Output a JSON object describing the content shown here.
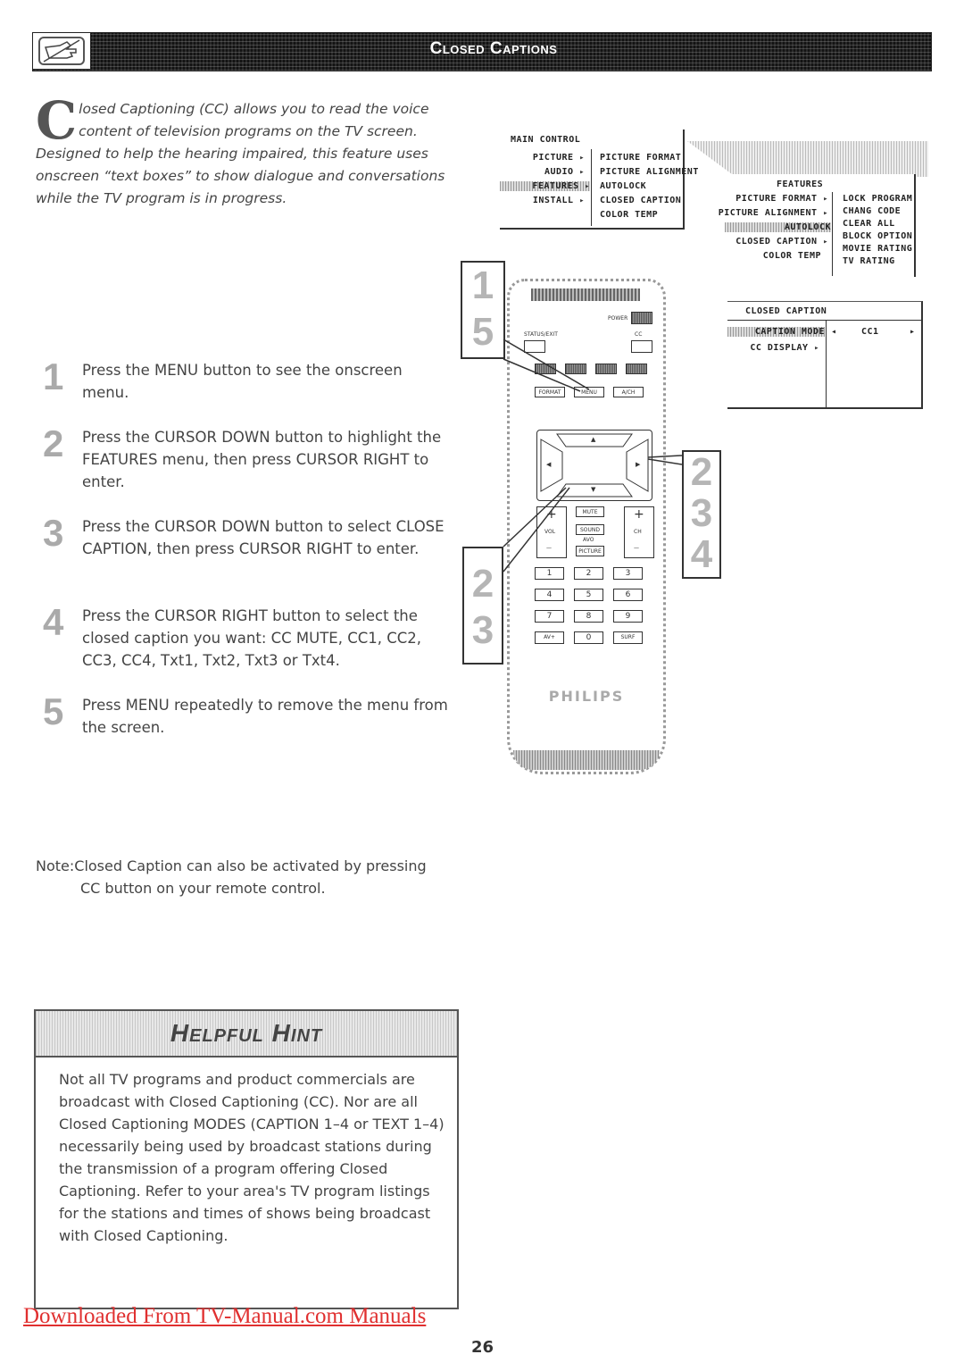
{
  "header": {
    "title": "Closed Captions",
    "icon": "hand-pointing-icon"
  },
  "intro": {
    "dropcap": "C",
    "text": "losed Captioning (CC) allows you to read the voice content of television programs on the TV screen. Designed to help the hearing impaired, this feature uses onscreen “text boxes” to show dialogue and conversations while the TV program is in progress."
  },
  "steps": [
    {
      "number": "1",
      "text": "Press the MENU button to see the onscreen menu."
    },
    {
      "number": "2",
      "text": "Press the CURSOR DOWN button to highlight the FEATURES menu, then press CURSOR RIGHT to enter."
    },
    {
      "number": "3",
      "text": "Press the CURSOR DOWN button to select CLOSE CAPTION, then press CURSOR RIGHT to enter."
    },
    {
      "number": "4",
      "text": "Press the CURSOR RIGHT button to select the closed caption you want: CC MUTE, CC1, CC2, CC3, CC4, Txt1, Txt2, Txt3 or Txt4."
    },
    {
      "number": "5",
      "text": "Press MENU repeatedly to remove the menu from the screen."
    }
  ],
  "note": {
    "line1": "Note:Closed Caption can also be activated by pressing",
    "line2": "CC button on your remote control."
  },
  "hint": {
    "title": "Helpful Hint",
    "body": "Not all TV programs and product commercials are broadcast with Closed Captioning (CC). Nor are all Closed Captioning MODES (CAPTION 1–4 or TEXT 1–4) necessarily being used by broadcast stations during the transmission of a program offering Closed Captioning. Refer to your area's TV program listings for the stations and times of shows being broadcast with Closed Captioning."
  },
  "footer": {
    "download_link": "Downloaded From TV-Manual.com Manuals",
    "page_number": "26"
  },
  "main_menu": {
    "title": "MAIN CONTROL",
    "items": [
      "PICTURE",
      "AUDIO",
      "FEATURES",
      "INSTALL"
    ],
    "highlighted": "FEATURES",
    "submenu": [
      "PICTURE FORMAT",
      "PICTURE ALIGNMENT",
      "AUTOLOCK",
      "CLOSED CAPTION",
      "COLOR TEMP"
    ]
  },
  "features_menu": {
    "title": "FEATURES",
    "items": [
      "PICTURE FORMAT",
      "PICTURE ALIGNMENT",
      "AUTOLOCK",
      "CLOSED CAPTION",
      "COLOR TEMP"
    ],
    "highlighted": "AUTOLOCK",
    "submenu": [
      "LOCK PROGRAM",
      "CHANG CODE",
      "CLEAR ALL",
      "BLOCK OPTION",
      "MOVIE RATING",
      "TV RATING"
    ]
  },
  "caption_menu": {
    "title": "CLOSED CAPTION",
    "items": [
      "CAPTION MODE",
      "CC DISPLAY"
    ],
    "highlighted": "CAPTION MODE",
    "value": "CC1"
  },
  "remote": {
    "brand": "PHILIPS",
    "labels": {
      "power": "POWER",
      "status": "STATUS/EXIT",
      "cc": "CC",
      "format": "FORMAT",
      "menu": "MENU",
      "ach": "A/CH",
      "mute": "MUTE",
      "vol": "VOL",
      "ch": "CH",
      "sound": "SOUND",
      "avo": "AVO",
      "picture": "PICTURE",
      "plus": "+",
      "minus": "—",
      "av": "AV+",
      "surf": "SURF"
    },
    "numbers": [
      "1",
      "2",
      "3",
      "4",
      "5",
      "6",
      "7",
      "8",
      "9",
      "0"
    ]
  },
  "callouts": {
    "left_top": [
      "1",
      "5"
    ],
    "right": [
      "2",
      "3",
      "4"
    ],
    "left_bottom": [
      "2",
      "3"
    ]
  }
}
